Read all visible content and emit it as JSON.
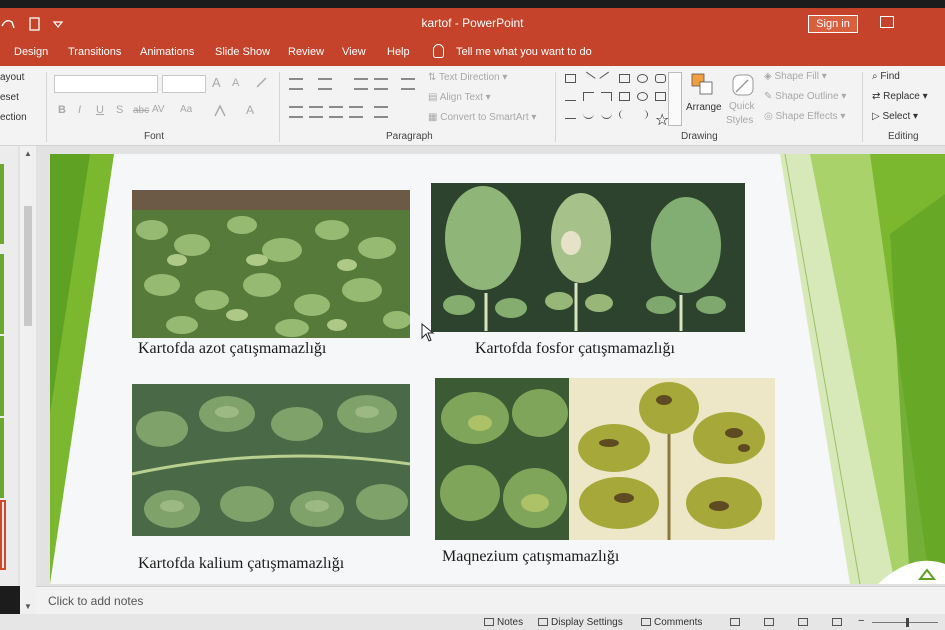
{
  "titlebar": {
    "title": "kartof  -  PowerPoint",
    "signin_label": "Sign in"
  },
  "tabs": [
    "Design",
    "Transitions",
    "Animations",
    "Slide Show",
    "Review",
    "View",
    "Help"
  ],
  "tell_me": "Tell me what you want to do",
  "ribbon": {
    "slides_group": [
      "ayout",
      "eset",
      "ection"
    ],
    "font_label": "Font",
    "font_size_a": "A",
    "paragraph_label": "Paragraph",
    "text_direction": "Text Direction",
    "align_text": "Align Text",
    "convert_smartart": "Convert to SmartArt",
    "drawing_label": "Drawing",
    "arrange": "Arrange",
    "quick_styles": [
      "Quick",
      "Styles"
    ],
    "shape_fill": "Shape Fill",
    "shape_outline": "Shape Outline",
    "shape_effects": "Shape Effects",
    "editing_label": "Editing",
    "find": "Find",
    "replace": "Replace",
    "select": "Select"
  },
  "slide": {
    "captions": [
      "Kartofda azot çatışmamazlığı",
      "Kartofda fosfor  çatışmamazlığı",
      "Kartofda kalium çatışmamazlığı",
      "Maqnezium çatışmamazlığı"
    ]
  },
  "notes_placeholder": "Click to add notes",
  "status": {
    "notes": "Notes",
    "display_settings": "Display Settings",
    "comments": "Comments"
  },
  "colors": {
    "accent": "#c5432a",
    "slide_green": "#6aa832"
  }
}
